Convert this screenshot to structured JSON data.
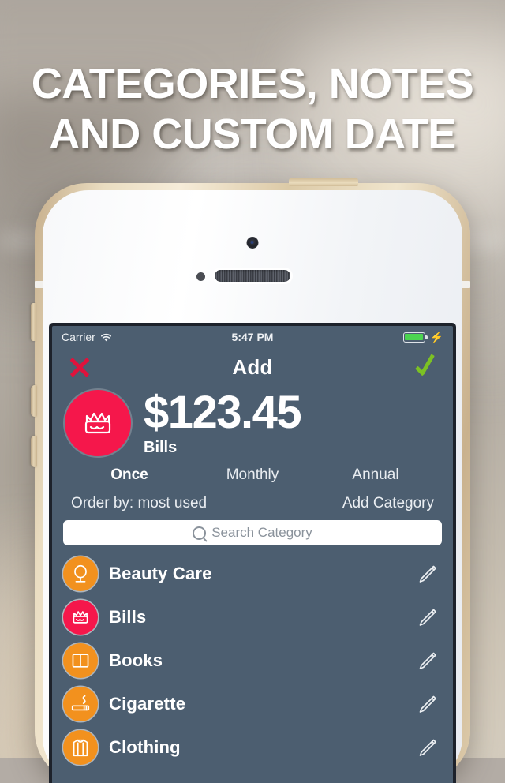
{
  "headline": {
    "line1": "CATEGORIES, NOTES",
    "line2": "AND CUSTOM DATE"
  },
  "device": {
    "name": "iphone-5s-gold-white",
    "frame_color": "#e2d2b2",
    "body_color": "#f7f8fa"
  },
  "screen": {
    "background_color": "#4c5e70",
    "status_bar": {
      "carrier": "Carrier",
      "wifi_icon": "wifi-icon",
      "time": "5:47 PM",
      "battery_icon": "battery-full-icon",
      "charging_icon": "lightning-bolt-icon",
      "battery_color": "#4cd551"
    },
    "nav_bar": {
      "close_icon": "close-x-icon",
      "close_color": "#e0123c",
      "title": "Add",
      "confirm_icon": "checkmark-icon",
      "confirm_color": "#7cc124"
    },
    "amount": {
      "badge_icon": "bills-crown-icon",
      "badge_color": "#f5174b",
      "value": "$123.45",
      "category_label": "Bills"
    },
    "frequency_tabs": [
      {
        "label": "Once",
        "active": true
      },
      {
        "label": "Monthly",
        "active": false
      },
      {
        "label": "Annual",
        "active": false
      }
    ],
    "order_row": {
      "order_by": "Order by: most used",
      "add_category": "Add Category"
    },
    "search": {
      "icon": "search-icon",
      "placeholder": "Search Category",
      "value": ""
    },
    "categories": [
      {
        "name": "Beauty Care",
        "icon": "mirror-icon",
        "color": "#f2911e",
        "edit_icon": "pencil-icon"
      },
      {
        "name": "Bills",
        "icon": "crown-icon",
        "color": "#f5174b",
        "edit_icon": "pencil-icon"
      },
      {
        "name": "Books",
        "icon": "book-icon",
        "color": "#f2911e",
        "edit_icon": "pencil-icon"
      },
      {
        "name": "Cigarette",
        "icon": "cigarette-icon",
        "color": "#f2911e",
        "edit_icon": "pencil-icon"
      },
      {
        "name": "Clothing",
        "icon": "shirt-icon",
        "color": "#f2911e",
        "edit_icon": "pencil-icon"
      }
    ]
  }
}
